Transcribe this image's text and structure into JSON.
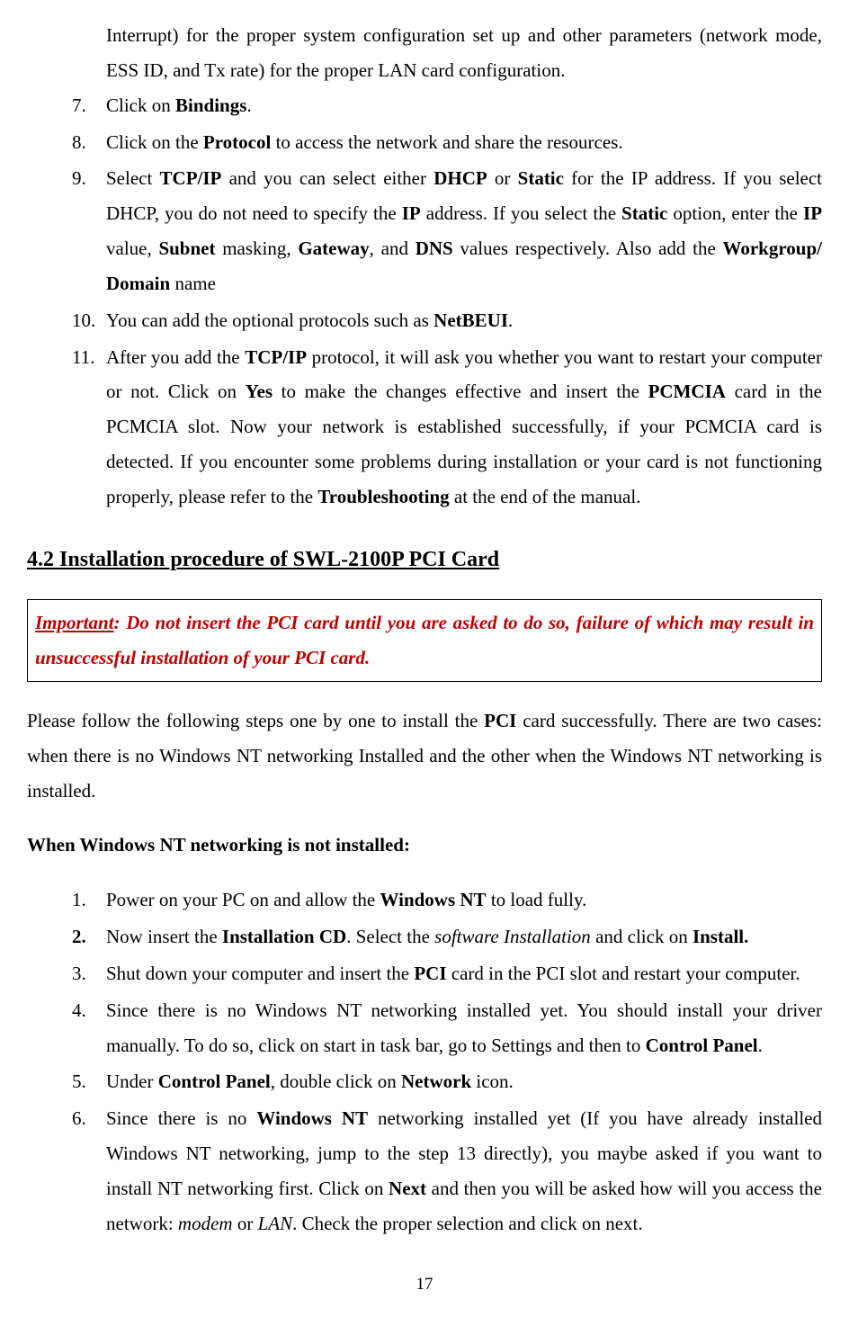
{
  "topList": {
    "continuation": "Interrupt) for the proper system configuration set up and other parameters (network mode, ESS ID, and Tx rate) for the proper LAN card configuration.",
    "item7": {
      "num": "7.",
      "html": "Click on <b>Bindings</b>."
    },
    "item8": {
      "num": "8.",
      "html": "Click on the <b>Protocol</b> to access the network and share the resources."
    },
    "item9": {
      "num": "9.",
      "html": "Select <b>TCP/IP</b> and you can select either <b>DHCP</b> or <b>Static</b> for the IP address. If you select DHCP, you do not need to specify the <b>IP</b> address. If you select the <b>Static</b> option, enter the <b>IP</b> value, <b>Subnet</b> masking, <b>Gateway</b>, and <b>DNS</b> values respectively. Also add the <b>Workgroup/ Domain</b> name"
    },
    "item10": {
      "num": "10.",
      "html": "You can add the optional protocols such as <b>NetBEUI</b>."
    },
    "item11": {
      "num": "11.",
      "html": "After you add the <b>TCP/IP</b> protocol, it will ask you whether you want to restart your computer or not. Click on <b>Yes</b> to make the changes effective and insert the <b>PCMCIA</b> card in the PCMCIA slot. Now your network is established successfully, if your PCMCIA card is detected. If you encounter some problems during installation or your card is not functioning properly, please refer to the <b>Troubleshooting</b> at the end of the manual."
    }
  },
  "sectionHeading": "4.2 Installation procedure of SWL-2100P PCI Card",
  "important": {
    "label": "Important",
    "rest": ": Do not insert the PCI card until you are asked to do so, failure of which may result in unsuccessful installation of your PCI card."
  },
  "introPara": "Please follow the following steps one by one to install the <b>PCI</b> card successfully. There are two cases: when there is no Windows NT networking Installed and the other when the Windows NT networking is installed.",
  "subHeading": "When Windows NT networking is not installed:",
  "bottomList": {
    "item1": {
      "num": "1.",
      "html": "Power on your PC on and allow the <b>Windows NT</b> to load fully."
    },
    "item2": {
      "num": "<b>2.</b>",
      "html": "Now insert the <b>Installation CD</b>. Select the <i>software Installation</i> and click on <b>Install.</b>"
    },
    "item3": {
      "num": "3.",
      "html": "Shut down your computer and insert the <b>PCI</b> card in the PCI slot and restart your computer."
    },
    "item4": {
      "num": "4.",
      "html": "Since there is no Windows NT networking installed yet. You should install your driver manually. To do so, click on start in task bar, go to Settings and then to <b>Control Panel</b>."
    },
    "item5": {
      "num": "5.",
      "html": "Under <b>Control Panel</b>, double click on <b>Network</b> icon."
    },
    "item6": {
      "num": "6.",
      "html": "Since there is no <b>Windows NT</b> networking installed yet (If you have already installed Windows NT networking, jump to the step 13 directly), you maybe asked if you want to install NT networking first. Click on <b>Next</b> and then you will be asked how will you access the network: <i>modem</i> or <i>LAN</i>. Check the proper selection and click on next."
    }
  },
  "pageNumber": "17"
}
